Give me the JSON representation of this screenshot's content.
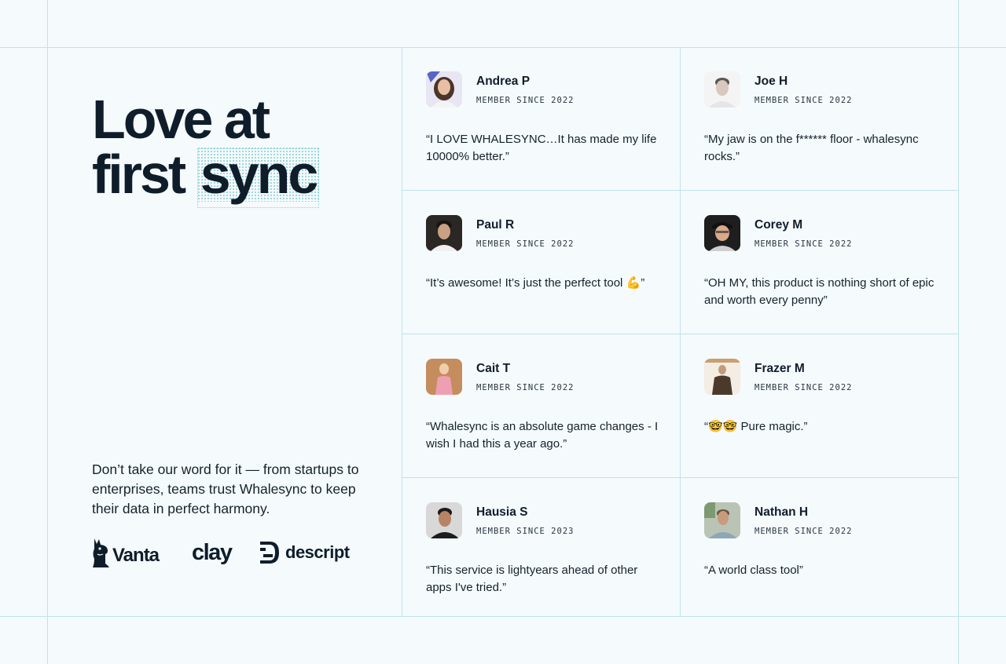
{
  "hero": {
    "headline_line1": "Love at",
    "headline_line2_prefix": "first",
    "headline_line2_highlight": "sync",
    "description": "Don’t take our word for it — from startups to enterprises, teams trust Whalesync to keep their data in perfect harmony."
  },
  "logos": [
    {
      "label": "Vanta",
      "icon": "llama-icon"
    },
    {
      "label": "clay",
      "icon": ""
    },
    {
      "label": "descript",
      "icon": "descript-mark-icon"
    }
  ],
  "testimonials": [
    {
      "name": "Andrea P",
      "since": "MEMBER SINCE 2022",
      "quote": "“I LOVE WHALESYNC…It has made my life 10000% better.”"
    },
    {
      "name": "Joe H",
      "since": "MEMBER SINCE 2022",
      "quote": "“My jaw is on the f****** floor - whalesync rocks.”"
    },
    {
      "name": "Paul R",
      "since": "MEMBER SINCE 2022",
      "quote": "“It’s awesome! It’s just the perfect tool 💪”"
    },
    {
      "name": "Corey M",
      "since": "MEMBER SINCE 2022",
      "quote": "“OH MY, this product is nothing short of epic and worth every penny”"
    },
    {
      "name": "Cait T",
      "since": "MEMBER SINCE 2022",
      "quote": "“Whalesync is an absolute game changes - I wish I had this a year ago.”"
    },
    {
      "name": "Frazer M",
      "since": "MEMBER SINCE 2022",
      "quote": "“🤓🤓 Pure magic.”"
    },
    {
      "name": "Hausia S",
      "since": "MEMBER SINCE 2023",
      "quote": "“This service is lightyears ahead of other apps I've tried.”"
    },
    {
      "name": "Nathan H",
      "since": "MEMBER SINCE 2022",
      "quote": "“A world class tool”"
    }
  ],
  "colors": {
    "background": "#f5fafc",
    "grid_line": "#bfe3ea",
    "text": "#0f1d2b",
    "highlight_dots": "#8fd3da"
  }
}
